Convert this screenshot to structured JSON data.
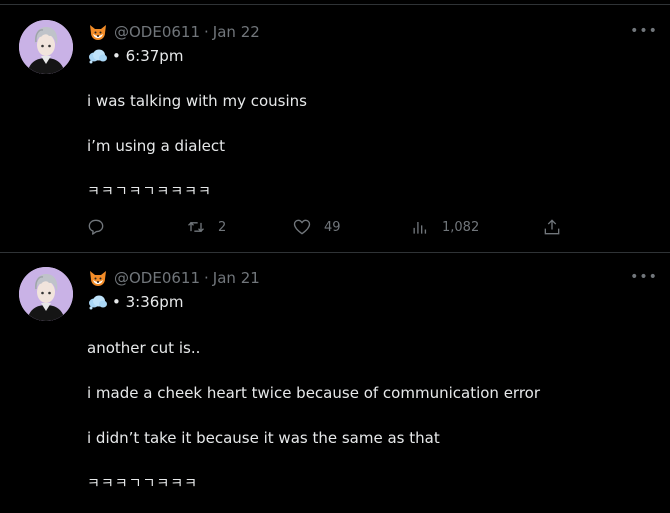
{
  "tweets": [
    {
      "handle": "@ODE0611",
      "separator": "·",
      "date": "Jan 22",
      "time_text": "• 6:37pm",
      "lines": [
        "i was talking with my cousins",
        "i’m using a dialect",
        "ㅋㅋㄱㅋㄱㅋㅋㅋㅋ"
      ],
      "actions": {
        "replies": "",
        "retweets": "2",
        "likes": "49",
        "views": "1,082"
      }
    },
    {
      "handle": "@ODE0611",
      "separator": "·",
      "date": "Jan 21",
      "time_text": "• 3:36pm",
      "lines": [
        "another cut is..",
        "i made a cheek heart twice because of communication error",
        "i didn’t take it because it was the same as that",
        "ㅋㅋㅋㄱㄱㅋㅋㅋ"
      ]
    }
  ],
  "icons": {
    "more": "more-horizontal-icon",
    "reply": "reply-icon",
    "retweet": "retweet-icon",
    "like": "heart-icon",
    "views": "views-icon",
    "share": "share-icon",
    "fox": "fox-emoji-icon",
    "cloud": "cloud-emoji-icon"
  },
  "colors": {
    "background": "#000000",
    "text": "#e7e9ea",
    "muted": "#71767b",
    "divider": "#2f3336",
    "avatar_bg": "#c9b2e6"
  }
}
